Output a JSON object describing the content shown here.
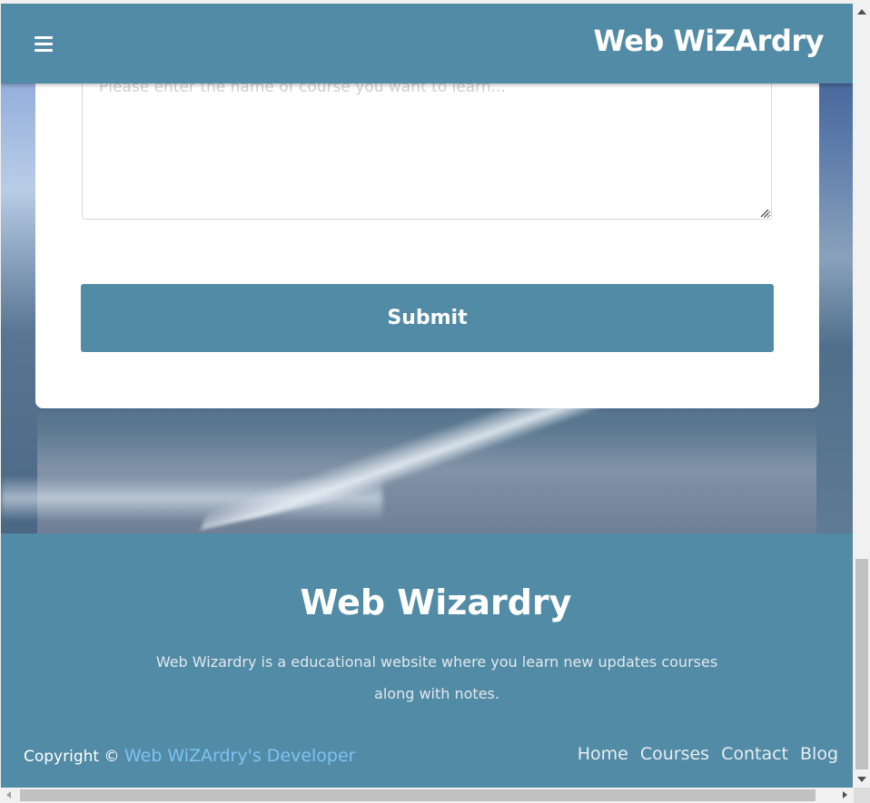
{
  "header": {
    "brand": "Web WiZArdry",
    "menu_icon": "hamburger-icon"
  },
  "form": {
    "course_textarea": {
      "placeholder": "Please enter the name of course you want to learn...",
      "value": ""
    },
    "submit_label": "Submit"
  },
  "footer": {
    "title": "Web Wizardry",
    "description": "Web Wizardry is a educational website where you learn new updates courses along with notes.",
    "copyright_prefix": "Copyright ©",
    "developer_link": "Web WiZArdry's Developer",
    "nav": [
      "Home",
      "Courses",
      "Contact",
      "Blog"
    ]
  },
  "colors": {
    "primary": "#528ba5",
    "link": "#7cc3f2",
    "card": "#ffffff"
  }
}
